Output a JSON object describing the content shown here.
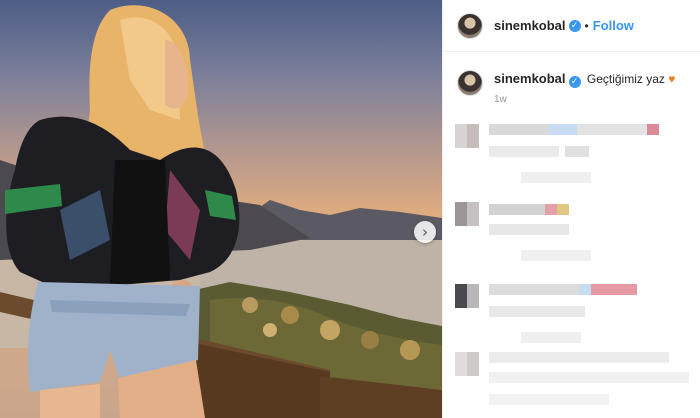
{
  "post": {
    "username": "sinemkobal",
    "verified_mark": "✓",
    "separator": "•",
    "follow_label": "Follow",
    "caption_username": "sinemkobal",
    "caption_text": "Geçtiğimiz yaz",
    "caption_emoji": "heart-emoji",
    "heart_glyph": "♥",
    "time_ago": "1w",
    "next_arrow": "›"
  },
  "colors": {
    "accent_blue": "#3897f0",
    "heart_orange": "#e67e22"
  },
  "icons": [
    "verified-badge-icon",
    "next-arrow-icon",
    "heart-emoji-icon"
  ]
}
